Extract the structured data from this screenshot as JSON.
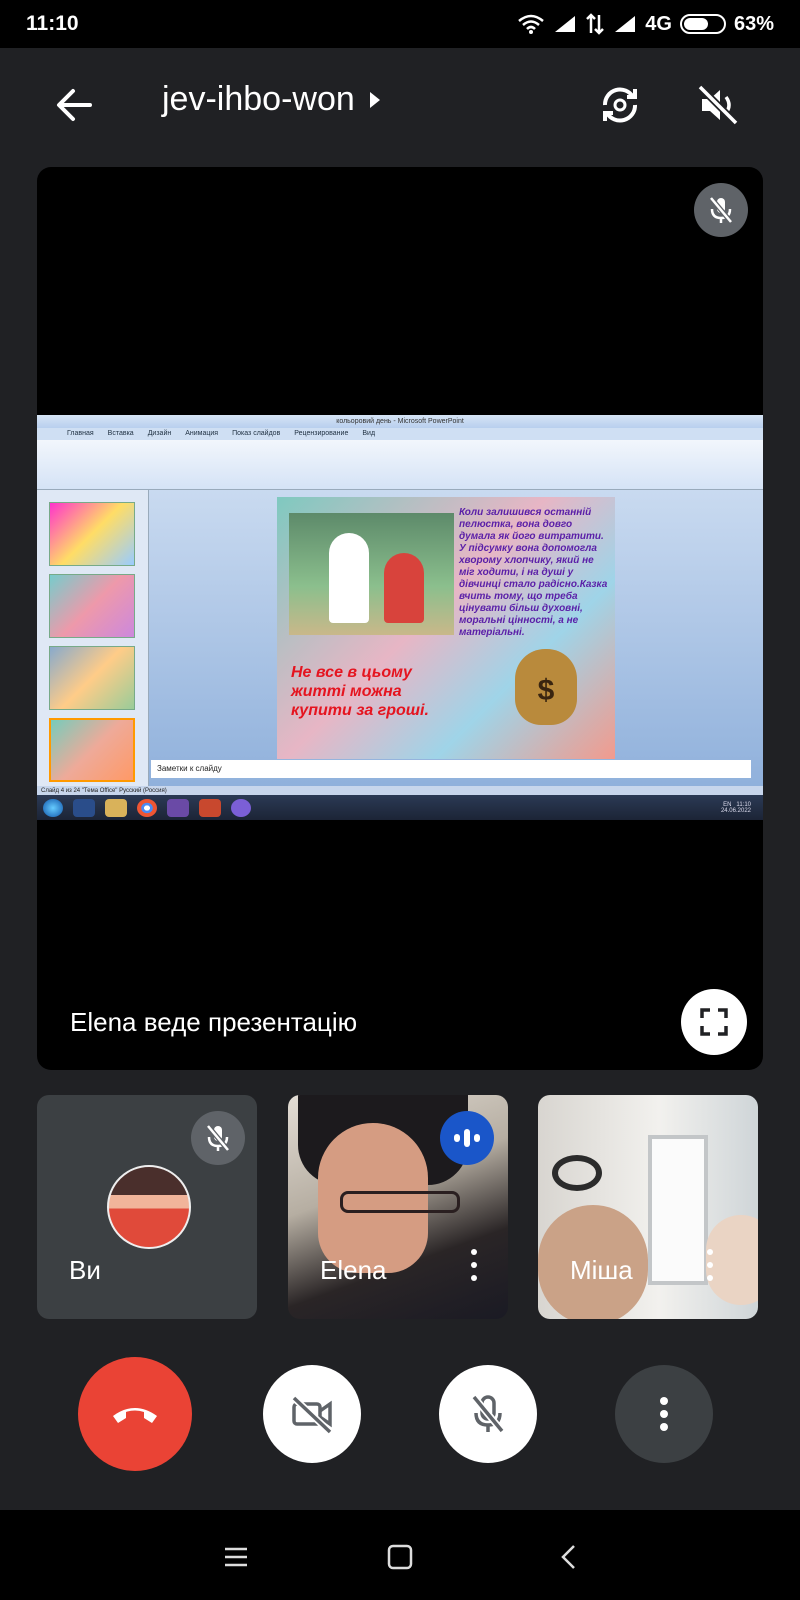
{
  "status_bar": {
    "time": "11:10",
    "network": "4G",
    "battery_text": "63%",
    "battery_level": 0.63
  },
  "header": {
    "meeting_code": "jev-ihbo-won"
  },
  "presentation": {
    "label": "Elena веде презентацію",
    "screen": {
      "window_title": "кольоровий день - Microsoft PowerPoint",
      "ribbon_tabs": [
        "Главная",
        "Вставка",
        "Дизайн",
        "Анимация",
        "Показ слайдов",
        "Рецензирование",
        "Вид"
      ],
      "slide_text": "Коли залишився останній пелюстка, вона довго думала як його витратити. У підсумку вона допомогла хворому хлопчику, який не міг ходити, і на душі у дівчинці стало радісно.Казка вчить тому, що треба цінувати більш духовні, моральні цінності, а не матеріальні.",
      "slide_red_text": "Не все в цьому житті можна купити за гроші.",
      "money_symbol": "$",
      "notes_placeholder": "Заметки к слайду",
      "status_text": "Слайд 4 из 24   \"Тема Office\"   Русский (Россия)",
      "clock_time": "11:10",
      "clock_date": "24.06.2022",
      "lang": "EN"
    }
  },
  "participants": [
    {
      "name": "Ви",
      "muted": true
    },
    {
      "name": "Elena",
      "speaking": true
    },
    {
      "name": "Міша"
    }
  ],
  "colors": {
    "hangup": "#ea4335",
    "speaking_badge": "#1a56c9",
    "tile_bg": "#3c4043",
    "page_bg": "#202124"
  }
}
